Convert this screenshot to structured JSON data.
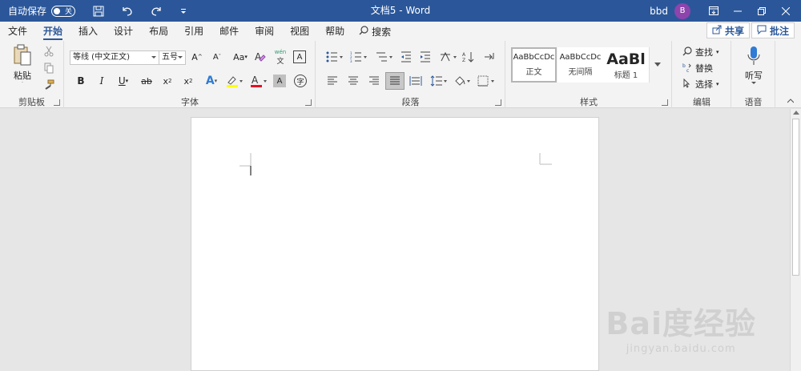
{
  "window": {
    "autosave_label": "自动保存",
    "autosave_state": "关",
    "doc_title": "文档5 - Word",
    "user_name": "bbd",
    "avatar_initial": "B",
    "accent_color": "#2b579a"
  },
  "tabs": [
    {
      "label": "文件",
      "active": false
    },
    {
      "label": "开始",
      "active": true
    },
    {
      "label": "插入",
      "active": false
    },
    {
      "label": "设计",
      "active": false
    },
    {
      "label": "布局",
      "active": false
    },
    {
      "label": "引用",
      "active": false
    },
    {
      "label": "邮件",
      "active": false
    },
    {
      "label": "审阅",
      "active": false
    },
    {
      "label": "视图",
      "active": false
    },
    {
      "label": "帮助",
      "active": false
    }
  ],
  "search_label": "搜索",
  "share_label": "共享",
  "comment_label": "批注",
  "ribbon": {
    "clipboard": {
      "label": "剪贴板",
      "paste_label": "粘贴"
    },
    "font": {
      "label": "字体",
      "font_name": "等线 (中文正文)",
      "font_size": "五号",
      "phonetic_top": "wén",
      "phonetic_bottom": "文"
    },
    "paragraph": {
      "label": "段落"
    },
    "styles": {
      "label": "样式",
      "items": [
        {
          "sample": "AaBbCcDc",
          "name": "正文"
        },
        {
          "sample": "AaBbCcDc",
          "name": "无间隔"
        },
        {
          "sample": "AaBl",
          "name": "标题 1"
        }
      ]
    },
    "editing": {
      "label": "编辑",
      "find": "查找",
      "replace": "替换",
      "select": "选择"
    },
    "voice": {
      "label": "语音",
      "dictate": "听写"
    }
  },
  "watermark": {
    "main": "Bai度经验",
    "sub": "jingyan.baidu.com"
  }
}
